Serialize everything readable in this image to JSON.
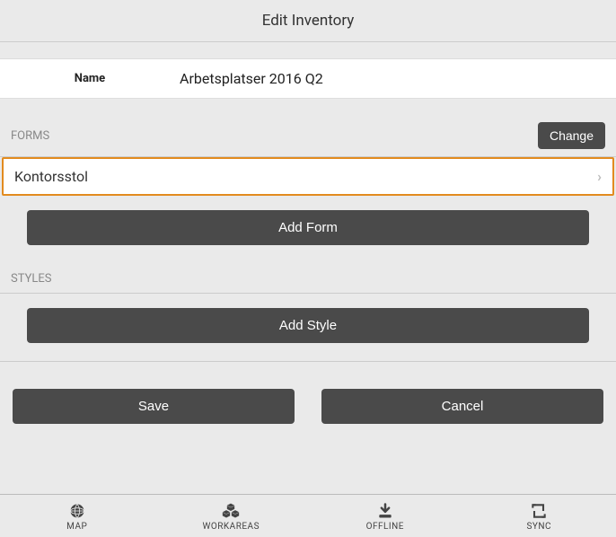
{
  "header": {
    "title": "Edit Inventory"
  },
  "name": {
    "label": "Name",
    "value": "Arbetsplatser 2016 Q2"
  },
  "forms": {
    "section_label": "FORMS",
    "change_label": "Change",
    "items": [
      {
        "label": "Kontorsstol"
      }
    ],
    "add_label": "Add Form"
  },
  "styles": {
    "section_label": "STYLES",
    "add_label": "Add Style"
  },
  "actions": {
    "save": "Save",
    "cancel": "Cancel"
  },
  "nav": {
    "map": "MAP",
    "workareas": "WORKAREAS",
    "offline": "OFFLINE",
    "sync": "SYNC"
  }
}
